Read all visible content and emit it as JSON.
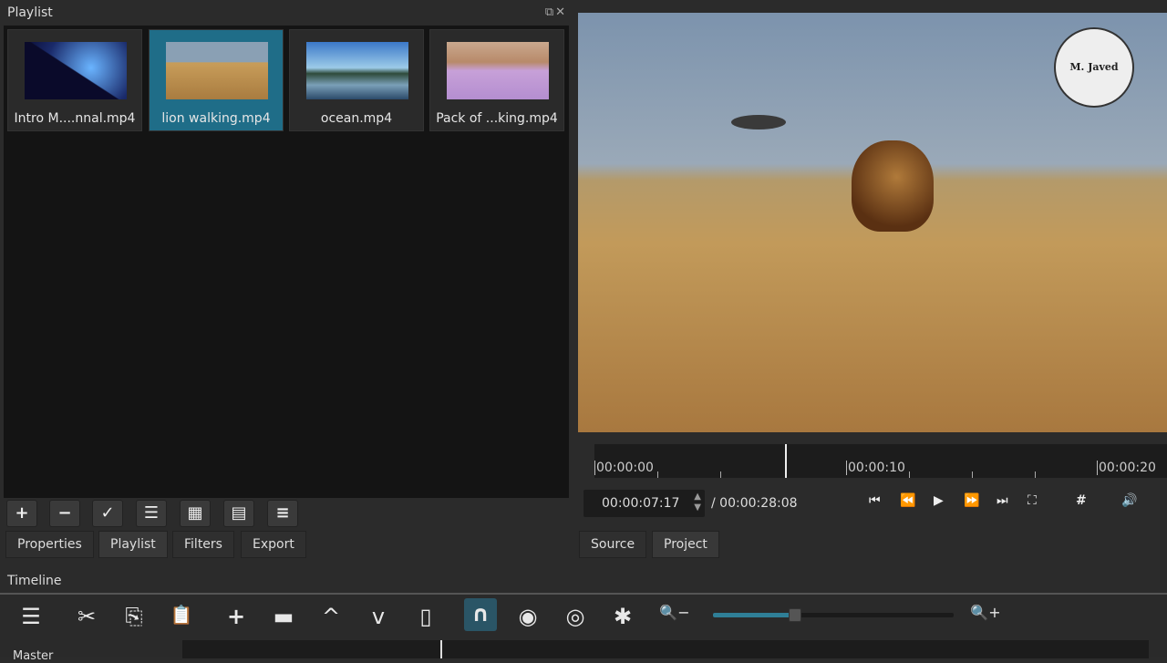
{
  "playlist": {
    "title": "Playlist",
    "controls": "⧉✕",
    "clips": [
      {
        "name": "Intro M....nnal.mp4",
        "selected": false
      },
      {
        "name": "lion walking.mp4",
        "selected": true
      },
      {
        "name": "ocean.mp4",
        "selected": false
      },
      {
        "name": "Pack of ...king.mp4",
        "selected": false
      }
    ],
    "toolbar": [
      "+",
      "−",
      "✓",
      "☰",
      "▦",
      "▤",
      "≡"
    ]
  },
  "tabs": {
    "left": [
      "Properties",
      "Playlist",
      "Filters",
      "Export"
    ],
    "active": "Playlist",
    "right": [
      "Source",
      "Project"
    ],
    "right_active": "Project"
  },
  "player": {
    "ruler": [
      "00:00:00",
      "00:00:10",
      "00:00:20"
    ],
    "current": "00:00:07:17",
    "total": "/ 00:00:28:08",
    "logo": "M. Javed",
    "controls": {
      "skip_start": "⏮",
      "rewind": "⏪",
      "play": "▶",
      "ffwd": "⏩",
      "skip_end": "⏭",
      "zoom": "⛶",
      "grid": "#",
      "volume": "🔊"
    }
  },
  "timeline": {
    "title": "Timeline",
    "track": "Master",
    "zoom_level": 0.2,
    "tools": {
      "menu": "☰",
      "cut": "✂",
      "copy": "⎘",
      "paste": "📋",
      "append": "+",
      "overwrite": "▬",
      "lift": "^",
      "overwrite_down": "v",
      "split": "▯",
      "snap": "∩",
      "scrub": "◉",
      "ripple": "◎",
      "ripple_all": "✱",
      "zoom_out": "🔍−",
      "zoom_in": "🔍+"
    }
  }
}
